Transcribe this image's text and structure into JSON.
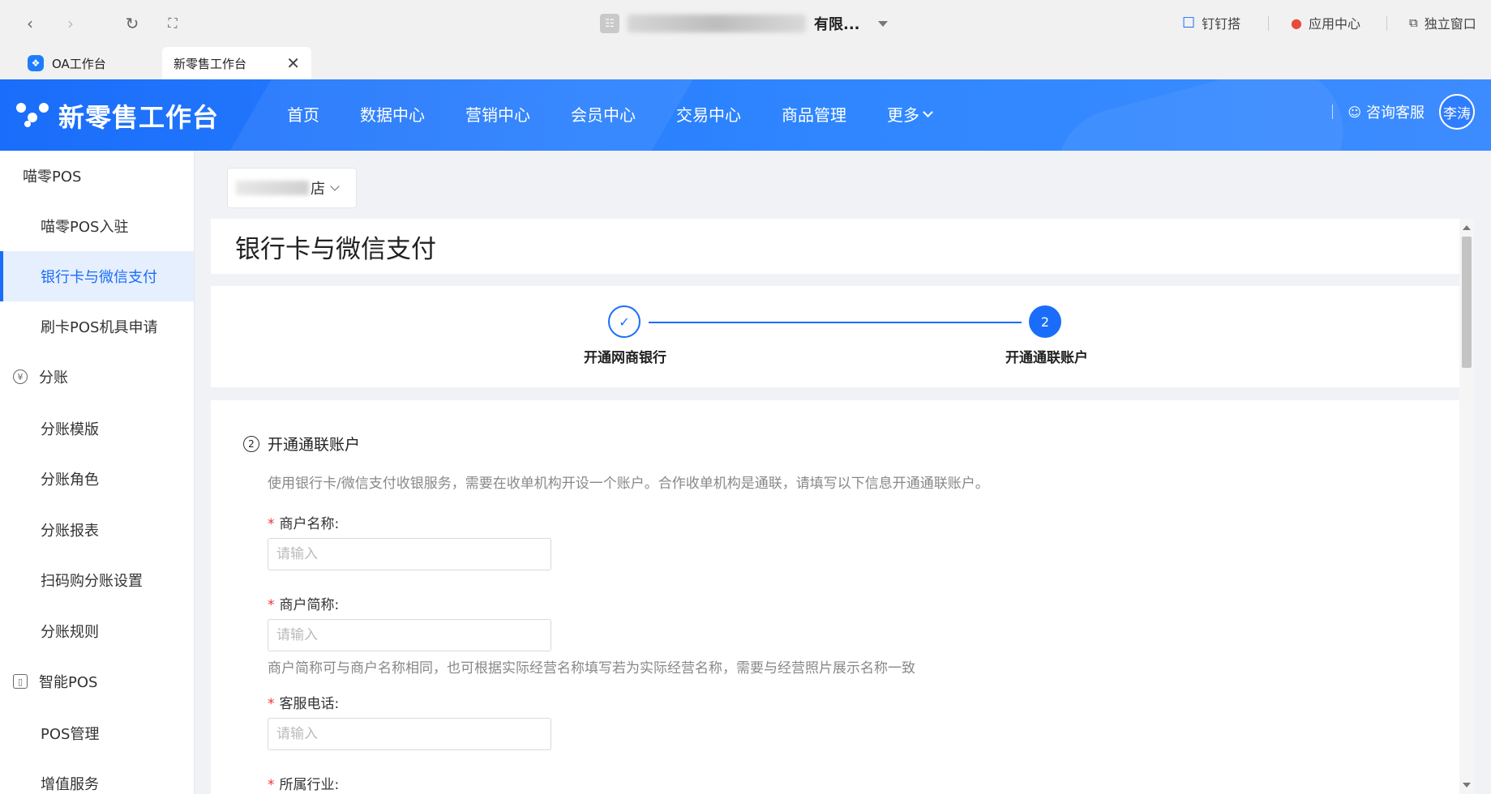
{
  "browser": {
    "address_title_visible": "有限...",
    "tools": {
      "dingtalk": "钉钉搭",
      "app_center": "应用中心",
      "standalone_window": "独立窗口"
    },
    "tabs": [
      {
        "label": "OA工作台",
        "active": false
      },
      {
        "label": "新零售工作台",
        "active": true
      }
    ]
  },
  "header": {
    "logo_text": "新零售工作台",
    "nav": [
      "首页",
      "数据中心",
      "营销中心",
      "会员中心",
      "交易中心",
      "商品管理"
    ],
    "more_label": "更多",
    "help_label": "咨询客服",
    "user_name": "李涛",
    "brand_color": "#1a6dfa"
  },
  "sidebar": {
    "items": [
      {
        "label": "喵零POS",
        "type": "group",
        "icon": null
      },
      {
        "label": "喵零POS入驻",
        "type": "sub"
      },
      {
        "label": "银行卡与微信支付",
        "type": "sub",
        "active": true
      },
      {
        "label": "刷卡POS机具申请",
        "type": "sub"
      },
      {
        "label": "分账",
        "type": "group",
        "icon": "yen-icon"
      },
      {
        "label": "分账模版",
        "type": "sub"
      },
      {
        "label": "分账角色",
        "type": "sub"
      },
      {
        "label": "分账报表",
        "type": "sub"
      },
      {
        "label": "扫码购分账设置",
        "type": "sub"
      },
      {
        "label": "分账规则",
        "type": "sub"
      },
      {
        "label": "智能POS",
        "type": "group",
        "icon": "device-icon"
      },
      {
        "label": "POS管理",
        "type": "sub"
      },
      {
        "label": "增值服务",
        "type": "sub"
      }
    ]
  },
  "store": {
    "suffix": "店"
  },
  "page": {
    "title": "银行卡与微信支付",
    "steps": [
      {
        "label": "开通网商银行",
        "state": "done"
      },
      {
        "label": "开通通联账户",
        "state": "current",
        "number": "2"
      }
    ],
    "section": {
      "number": "2",
      "title": "开通通联账户",
      "description": "使用银行卡/微信支付收银服务，需要在收单机构开设一个账户。合作收单机构是通联，请填写以下信息开通通联账户。"
    },
    "fields": [
      {
        "label": "商户名称:",
        "placeholder": "请输入",
        "value": ""
      },
      {
        "label": "商户简称:",
        "placeholder": "请输入",
        "value": "",
        "hint": "商户简称可与商户名称相同，也可根据实际经营名称填写若为实际经营名称，需要与经营照片展示名称一致"
      },
      {
        "label": "客服电话:",
        "placeholder": "请输入",
        "value": ""
      },
      {
        "label": "所属行业:"
      }
    ]
  }
}
